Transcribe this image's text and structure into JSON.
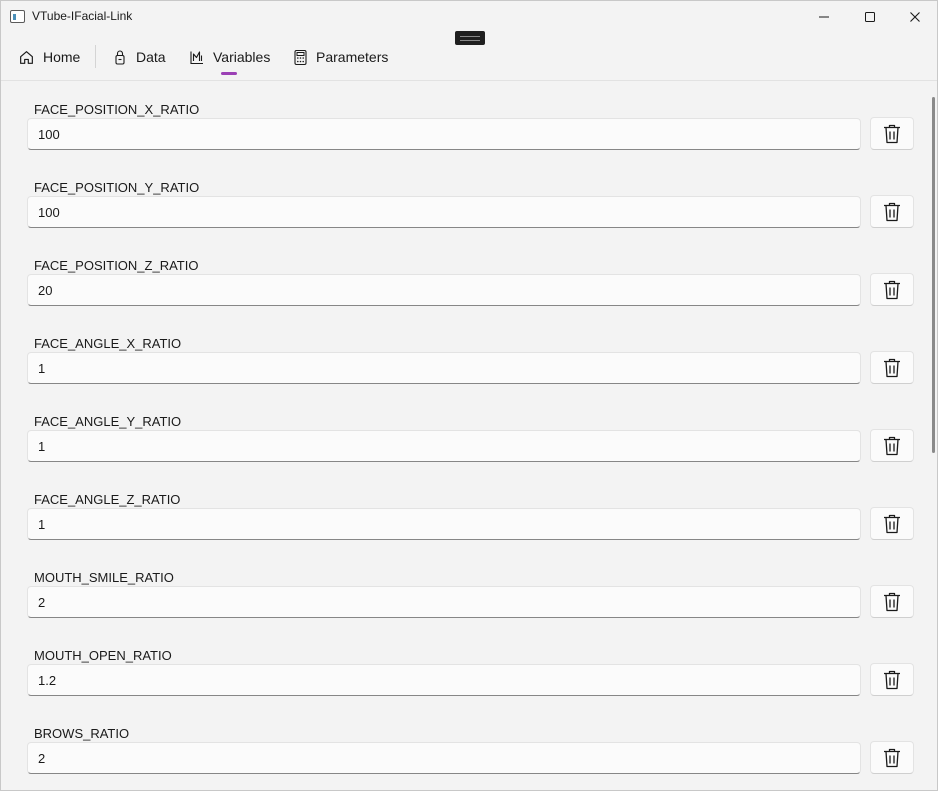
{
  "window": {
    "title": "VTube-IFacial-Link"
  },
  "nav": {
    "items": [
      {
        "label": "Home",
        "icon": "home-icon"
      },
      {
        "label": "Data",
        "icon": "data-icon"
      },
      {
        "label": "Variables",
        "icon": "variables-icon",
        "selected": true
      },
      {
        "label": "Parameters",
        "icon": "calculator-icon"
      }
    ]
  },
  "variables": [
    {
      "name": "FACE_POSITION_X_RATIO",
      "value": "100"
    },
    {
      "name": "FACE_POSITION_Y_RATIO",
      "value": "100"
    },
    {
      "name": "FACE_POSITION_Z_RATIO",
      "value": "20"
    },
    {
      "name": "FACE_ANGLE_X_RATIO",
      "value": "1"
    },
    {
      "name": "FACE_ANGLE_Y_RATIO",
      "value": "1"
    },
    {
      "name": "FACE_ANGLE_Z_RATIO",
      "value": "1"
    },
    {
      "name": "MOUTH_SMILE_RATIO",
      "value": "2"
    },
    {
      "name": "MOUTH_OPEN_RATIO",
      "value": "1.2"
    },
    {
      "name": "BROWS_RATIO",
      "value": "2"
    }
  ],
  "colors": {
    "accent": "#9b40b5",
    "background": "#f3f3f3"
  }
}
